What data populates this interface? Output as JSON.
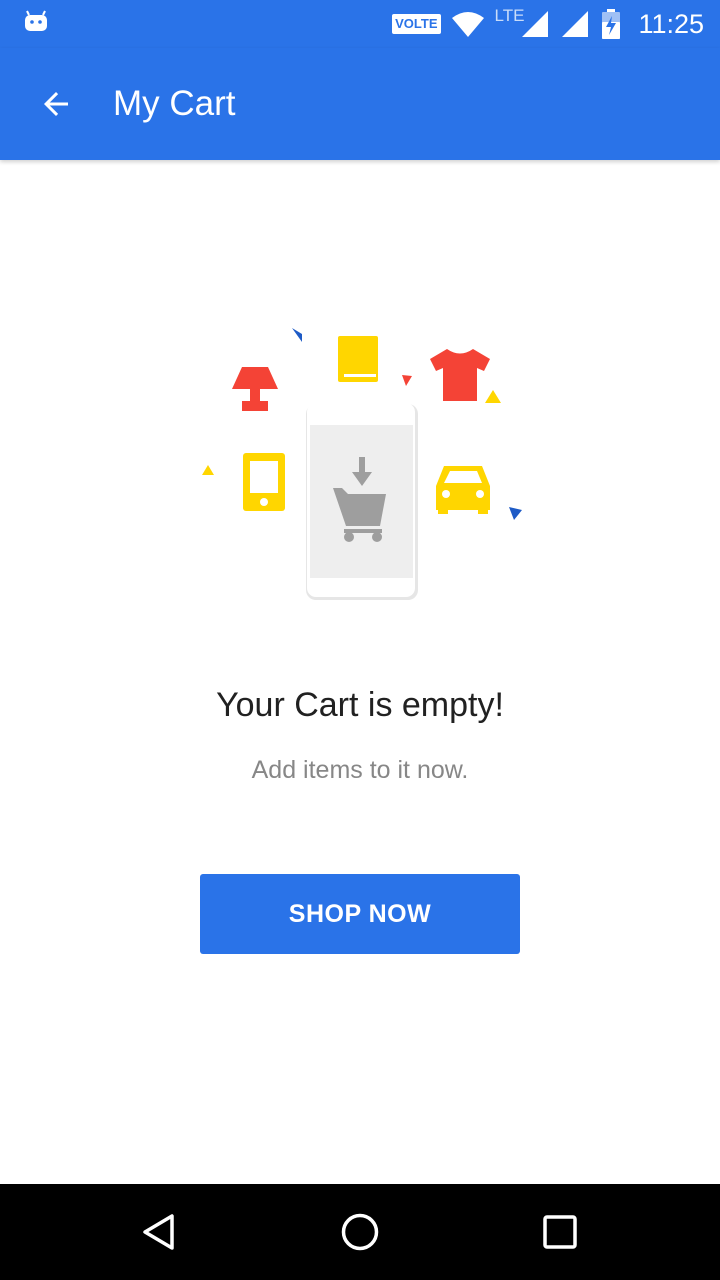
{
  "status_bar": {
    "volte_label": "VOLTE",
    "network_label": "LTE",
    "time": "11:25",
    "icons": [
      "android-notification-icon",
      "wifi-icon",
      "cell-signal-icon",
      "cell-signal-icon",
      "battery-charging-icon"
    ]
  },
  "app_bar": {
    "title": "My Cart",
    "back_icon": "arrow-back-icon",
    "background_color": "#2a73e8"
  },
  "empty_state": {
    "illustration_icons": [
      "lamp-icon",
      "book-icon",
      "tshirt-icon",
      "mobile-phone-icon",
      "car-icon",
      "phone-cart-icon",
      "cart-download-icon"
    ],
    "title": "Your Cart is empty!",
    "subtitle": "Add items to it now.",
    "button_label": "SHOP NOW"
  },
  "nav_bar": {
    "icons": [
      "back-triangle-icon",
      "home-circle-icon",
      "recents-square-icon"
    ]
  },
  "colors": {
    "primary": "#2a73e8",
    "accent_red": "#f44336",
    "accent_yellow": "#ffd600",
    "accent_blue": "#1e5bc6",
    "title_text": "#212121",
    "subtitle_text": "#878787"
  }
}
